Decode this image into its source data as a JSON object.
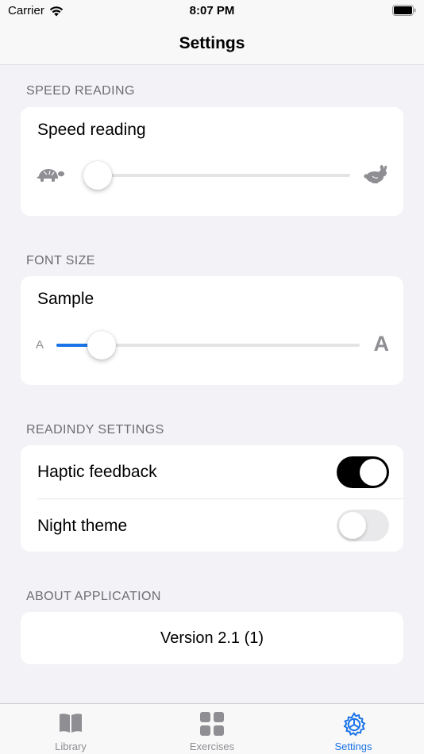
{
  "status_bar": {
    "carrier": "Carrier",
    "time": "8:07 PM"
  },
  "nav": {
    "title": "Settings"
  },
  "speed_section": {
    "header": "SPEED READING",
    "label": "Speed reading",
    "slider_value": 0.0,
    "left_icon": "turtle-icon",
    "right_icon": "rabbit-icon"
  },
  "font_section": {
    "header": "FONT SIZE",
    "label": "Sample",
    "slider_value": 0.15,
    "small_glyph": "A",
    "large_glyph": "A"
  },
  "readindy_section": {
    "header": "READINDY SETTINGS",
    "haptic_label": "Haptic feedback",
    "haptic_on": true,
    "night_label": "Night theme",
    "night_on": false
  },
  "about_section": {
    "header": "ABOUT APPLICATION",
    "version": "Version 2.1 (1)"
  },
  "tabs": [
    {
      "label": "Library",
      "icon": "book-icon",
      "active": false
    },
    {
      "label": "Exercises",
      "icon": "grid-icon",
      "active": false
    },
    {
      "label": "Settings",
      "icon": "settings-gear-icon",
      "active": true
    }
  ],
  "colors": {
    "accent": "#1a73e8",
    "toggle_on": "#000000",
    "background": "#f2f2f7"
  }
}
